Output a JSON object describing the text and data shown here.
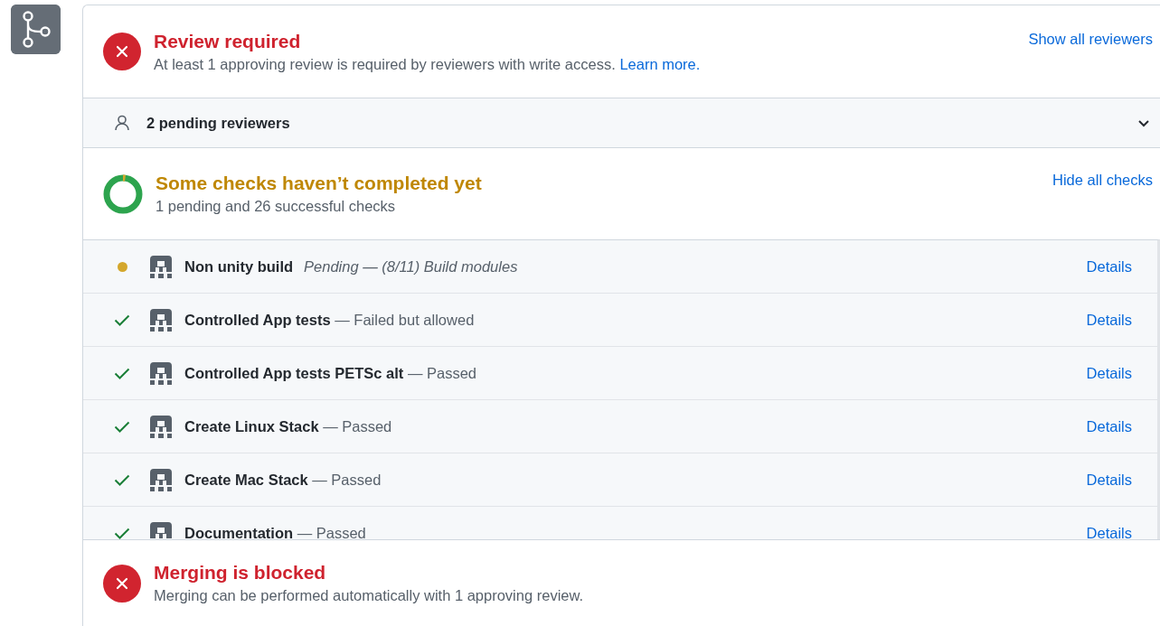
{
  "review": {
    "title": "Review required",
    "description": "At least 1 approving review is required by reviewers with write access.",
    "link": "Learn more.",
    "action": "Show all reviewers"
  },
  "reviewers": {
    "label": "2 pending reviewers",
    "expanded": false
  },
  "checks": {
    "title": "Some checks haven’t completed yet",
    "summary": "1 pending and 26 successful checks",
    "action": "Hide all checks",
    "rows": [
      {
        "kind": "pending",
        "name": "Non unity build",
        "description": "Pending — (8/11) Build modules",
        "link": "Details"
      },
      {
        "kind": "success",
        "name": "Controlled App tests",
        "description": "— Failed but allowed",
        "link": "Details"
      },
      {
        "kind": "success",
        "name": "Controlled App tests PETSc alt",
        "description": "— Passed",
        "link": "Details"
      },
      {
        "kind": "success",
        "name": "Create Linux Stack",
        "description": "— Passed",
        "link": "Details"
      },
      {
        "kind": "success",
        "name": "Create Mac Stack",
        "description": "— Passed",
        "link": "Details"
      },
      {
        "kind": "success",
        "name": "Documentation",
        "description": "— Passed",
        "link": "Details"
      }
    ]
  },
  "merge": {
    "title": "Merging is blocked",
    "description": "Merging can be performed automatically with 1 approving review."
  }
}
